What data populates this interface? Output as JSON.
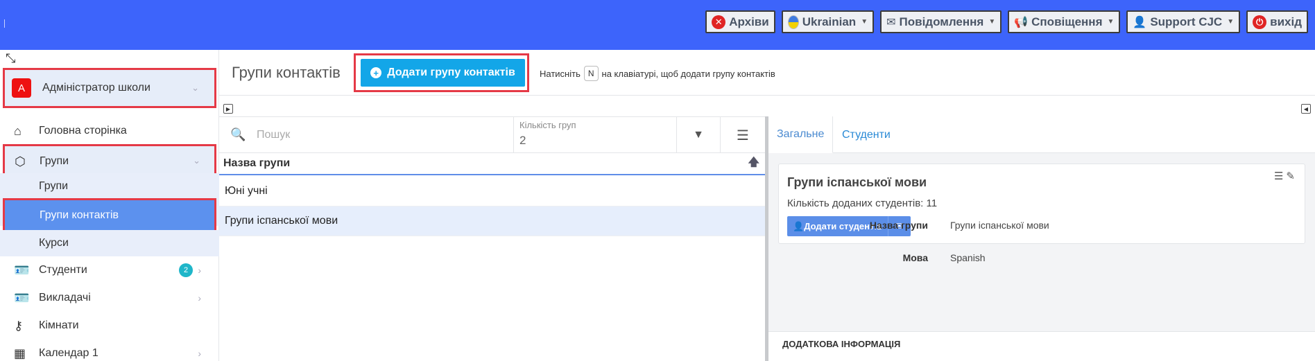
{
  "topbar": {
    "archive": "Архіви",
    "language": "Ukrainian",
    "messages": "Повідомлення",
    "notifications": "Сповіщення",
    "user": "Support CJC",
    "logout": "вихід",
    "bg_color": "#3d64fb"
  },
  "sidebar": {
    "admin_avatar": "A",
    "admin_label": "Адміністратор школи",
    "items": [
      {
        "label": "Головна сторінка",
        "icon": "home-icon"
      },
      {
        "label": "Групи",
        "icon": "box-icon"
      },
      {
        "label": "Студенти",
        "icon": "id-card-icon",
        "badge": "2"
      },
      {
        "label": "Викладачі",
        "icon": "id-card-icon"
      },
      {
        "label": "Кімнати",
        "icon": "key-icon"
      },
      {
        "label": "Календар 1",
        "icon": "calendar-icon"
      }
    ],
    "sub_items": [
      {
        "label": "Групи"
      },
      {
        "label": "Групи контактів"
      },
      {
        "label": "Курси"
      }
    ]
  },
  "header": {
    "title": "Групи контактів",
    "add_button": "Додати групу контактів",
    "hint_prefix": "Натисніть",
    "hint_key": "N",
    "hint_suffix": "на клавіатурі, щоб додати групу контактів"
  },
  "list": {
    "search_placeholder": "Пошук",
    "count_label": "Кількість груп",
    "count_value": "2",
    "column_header": "Назва групи",
    "rows": [
      {
        "name": "Юні учні"
      },
      {
        "name": "Групи іспанської мови"
      }
    ]
  },
  "detail": {
    "tabs": [
      "Загальне",
      "Студенти"
    ],
    "card_title": "Групи іспанської мови",
    "card_sub": "Кількість доданих студентів: 11",
    "add_students": "Додати студентів",
    "fields": [
      {
        "label": "Назва групи",
        "value": "Групи іспанської мови"
      },
      {
        "label": "Мова",
        "value": "Spanish"
      }
    ],
    "extra_header": "ДОДАТКОВА ІНФОРМАЦІЯ"
  }
}
